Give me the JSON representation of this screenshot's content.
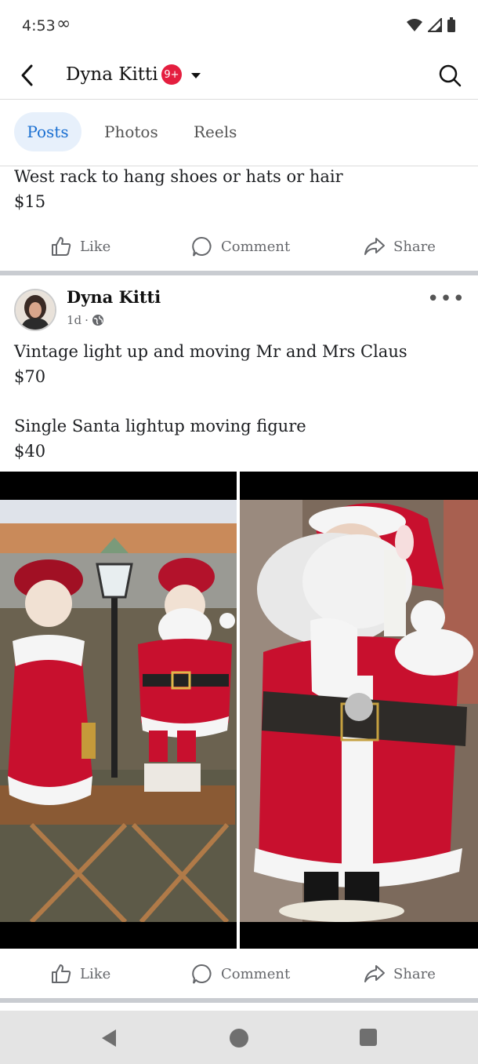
{
  "status_bar": {
    "time": "4:53",
    "infinity_icon": "∞"
  },
  "header": {
    "title": "Dyna Kitti",
    "badge": "9+"
  },
  "tabs": [
    {
      "label": "Posts"
    },
    {
      "label": "Photos"
    },
    {
      "label": "Reels"
    }
  ],
  "post1": {
    "text_line1": "West rack to hang shoes or hats or hair",
    "text_line2": "$15",
    "actions": {
      "like": "Like",
      "comment": "Comment",
      "share": "Share"
    }
  },
  "post2": {
    "author": "Dyna Kitti",
    "time": "1d",
    "separator": "·",
    "line1": "Vintage light up and moving Mr and Mrs Claus",
    "line2": "$70",
    "line3": "Single Santa lightup moving figure",
    "line4": "$40",
    "actions": {
      "like": "Like",
      "comment": "Comment",
      "share": "Share"
    }
  },
  "colors": {
    "accent": "#1a6fd1",
    "badge": "#e41e3f",
    "divider": "#c9ccd1",
    "santa_red": "#c8102e"
  },
  "icons": [
    "back-arrow-icon",
    "caret-down-icon",
    "search-icon",
    "like-icon",
    "comment-icon",
    "share-icon",
    "globe-icon",
    "more-icon",
    "wifi-icon",
    "signal-icon",
    "battery-icon",
    "nav-back-icon",
    "nav-home-icon",
    "nav-recents-icon"
  ]
}
